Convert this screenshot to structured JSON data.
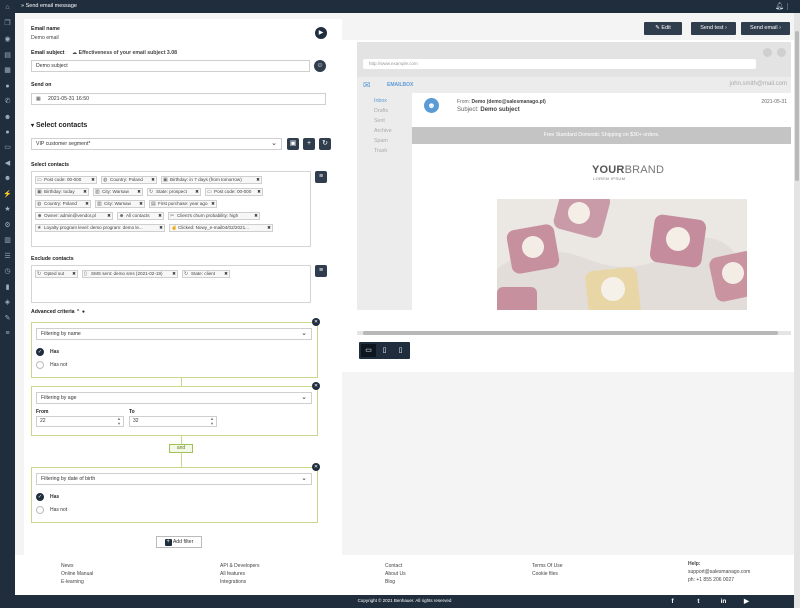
{
  "topbar": {
    "title": "Send email message"
  },
  "sidebar": {
    "icons": [
      "home-icon",
      "copy-icon",
      "eye-icon",
      "id-card-icon",
      "grid-icon",
      "help-icon",
      "phone-icon",
      "users-icon",
      "chat-icon",
      "monitor-icon",
      "megaphone-icon",
      "group-icon",
      "plug-icon",
      "star-icon",
      "gear-icon",
      "chart-icon",
      "list-icon",
      "clock-icon",
      "database-icon",
      "layers-icon",
      "wrench-icon",
      "sliders-icon"
    ]
  },
  "form": {
    "email_name_label": "Email name",
    "email_name_value": "Demo email",
    "email_subject_label": "Email subject",
    "effectiveness_label": "Effectiveness of your email subject",
    "effectiveness_value": "3.08",
    "subject_value": "Demo subject",
    "send_on_label": "Send on",
    "send_on_value": "2021-05-31 16:50",
    "select_contacts_heading": "Select contacts",
    "segment_value": "VIP customer segment*",
    "select_contacts_label": "Select contacts",
    "contact_tags": [
      "Post code: 00-000",
      "Country: Poland",
      "Birthday: in 7 days (from tomorrow)",
      "Birthday: today",
      "City: Warsaw",
      "State: prospect",
      "Post code: 00-000",
      "Country: Poland",
      "City: Warsaw",
      "First purchase: year ago",
      "Owner: admin@vendor.pl",
      "All contacts",
      "Client's churn probability: high",
      "Loyalty program level: demo program: demo le...",
      "Clicked: Nowy_e-mail04/02/2021..."
    ],
    "exclude_label": "Exclude contacts",
    "exclude_tags": [
      "Opted out",
      "SMS sent: demo sms (2021-02-19)",
      "State: client"
    ],
    "advanced_label": "Advanced criteria",
    "filters": [
      {
        "title": "Filtering by name",
        "options": [
          "Has",
          "Has not"
        ],
        "selected": "Has"
      },
      {
        "title": "Filtering by age",
        "from_label": "From",
        "from_value": "22",
        "to_label": "To",
        "to_value": "32"
      },
      {
        "title": "Filtering by date of birth",
        "options": [
          "Has",
          "Has not"
        ],
        "selected": "Has"
      }
    ],
    "and_label": "and",
    "add_filter_label": "Add filter"
  },
  "actions": {
    "edit": "Edit",
    "send_test": "Send test",
    "send_email": "Send email"
  },
  "preview": {
    "address": "http://www.example.com",
    "mailbox_title": "EMAILBOX",
    "user_email": "john.smith@mail.com",
    "folders": [
      "Inbox",
      "Drafts",
      "Sent",
      "Archive",
      "Spam",
      "Trash"
    ],
    "from_prefix": "From:",
    "from_value": "Demo (demo@salesmanago.pl)",
    "subject_prefix": "Subject:",
    "subject_value": "Demo subject",
    "date": "2021-05-31",
    "banner": "Free Standard Domestic Shipping on $30+ orders.",
    "brand_bold": "YOUR",
    "brand_thin": "BRAND",
    "brand_sub": "LOREM IPSUM"
  },
  "footer": {
    "col1": [
      "News",
      "Online Manual",
      "E-learning"
    ],
    "col2": [
      "API & Developers",
      "All features",
      "Integrations"
    ],
    "col3": [
      "Contact",
      "About Us",
      "Blog"
    ],
    "col4": [
      "Terms Of Use",
      "Cookie files"
    ],
    "help_title": "Help:",
    "help_email": "support@salesmanago.com",
    "help_phone": "ph: +1 855 206 0027",
    "copyright": "Copyright © 2021 Benhauer. All rights reserved",
    "social": [
      "facebook-icon",
      "twitter-icon",
      "linkedin-icon",
      "youtube-icon"
    ]
  },
  "colors": {
    "navy": "#1f2d3d",
    "filter_border": "#c8d98b",
    "accent_blue": "#5b9bd5"
  }
}
